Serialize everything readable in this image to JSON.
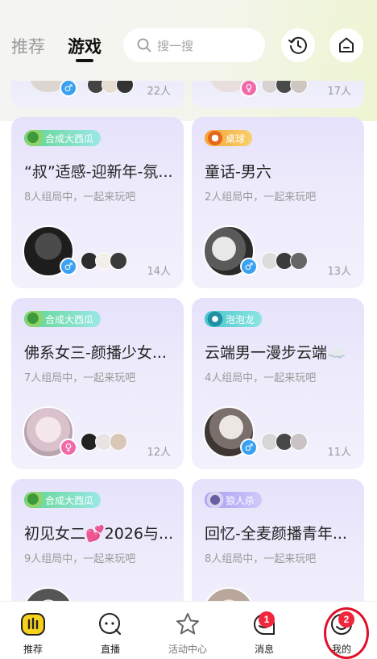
{
  "header": {
    "tabs": [
      {
        "label": "推荐",
        "active": false
      },
      {
        "label": "游戏",
        "active": true
      }
    ],
    "search_placeholder": "搜一搜",
    "icons": [
      "search-icon",
      "history-icon",
      "home-icon"
    ]
  },
  "top_cards": [
    {
      "count": "22人",
      "host_gender": "male"
    },
    {
      "count": "17人",
      "host_gender": "female"
    }
  ],
  "cards": [
    {
      "tag": "合成大西瓜",
      "tag_style": "green",
      "title": "“叔”适感-迎新年-氛...",
      "subtitle": "8人组局中，一起来玩吧",
      "count": "14人",
      "host_gender": "male"
    },
    {
      "tag": "桌球",
      "tag_style": "orange",
      "title": "童话-男六",
      "subtitle": "2人组局中，一起来玩吧",
      "count": "13人",
      "host_gender": "male"
    },
    {
      "tag": "合成大西瓜",
      "tag_style": "green",
      "title": "佛系女三-颜播少女...",
      "subtitle": "7人组局中，一起来玩吧",
      "count": "12人",
      "host_gender": "female"
    },
    {
      "tag": "泡泡龙",
      "tag_style": "teal",
      "title": "云端男一漫步云端☁️",
      "subtitle": "4人组局中，一起来玩吧",
      "count": "11人",
      "host_gender": "male"
    },
    {
      "tag": "合成大西瓜",
      "tag_style": "green",
      "title": "初见女二💕2026与...",
      "subtitle": "9人组局中，一起来玩吧",
      "count": "",
      "host_gender": "female"
    },
    {
      "tag": "狼人杀",
      "tag_style": "purple",
      "title": "回忆-全麦颜播青年...",
      "subtitle": "8人组局中，一起来玩吧",
      "count": "",
      "host_gender": "male"
    }
  ],
  "bottom_nav": [
    {
      "label": "推荐",
      "icon": "recommend-icon",
      "active": true,
      "badge": ""
    },
    {
      "label": "直播",
      "icon": "live-icon",
      "active": false,
      "badge": ""
    },
    {
      "label": "活动中心",
      "icon": "star-icon",
      "active": false,
      "badge": ""
    },
    {
      "label": "消息",
      "icon": "message-icon",
      "active": false,
      "badge": "1"
    },
    {
      "label": "我的",
      "icon": "profile-icon",
      "active": false,
      "badge": "2"
    }
  ],
  "colors": {
    "accent_yellow": "#f7d21c",
    "badge_red": "#f1263d",
    "highlight_red": "#e0102a"
  }
}
